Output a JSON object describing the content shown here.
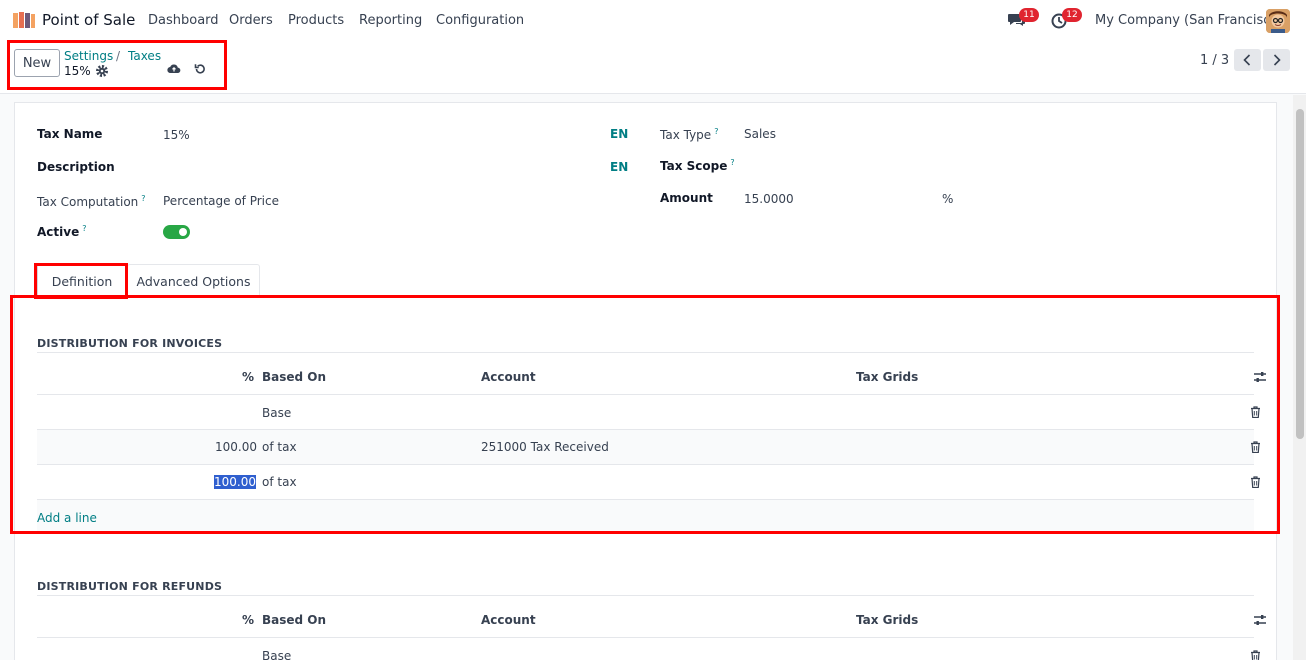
{
  "navbar": {
    "app_name": "Point of Sale",
    "menus": [
      "Dashboard",
      "Orders",
      "Products",
      "Reporting",
      "Configuration"
    ],
    "messages_count": "11",
    "activities_count": "12",
    "company": "My Company (San Francisco)"
  },
  "control": {
    "new_label": "New",
    "breadcrumb": [
      "Settings",
      "Taxes"
    ],
    "breadcrumb_sep": "/",
    "record_name": "15%",
    "pager": "1 / 3"
  },
  "form": {
    "tax_name_label": "Tax Name",
    "tax_name_value": "15%",
    "description_label": "Description",
    "lang_tag": "EN",
    "tax_computation_label": "Tax Computation",
    "tax_computation_value": "Percentage of Price",
    "active_label": "Active",
    "active_value": true,
    "tax_type_label": "Tax Type",
    "tax_type_value": "Sales",
    "tax_scope_label": "Tax Scope",
    "amount_label": "Amount",
    "amount_value": "15.0000",
    "amount_unit": "%",
    "help_mark": "?"
  },
  "tabs": [
    "Definition",
    "Advanced Options"
  ],
  "invoices": {
    "title": "DISTRIBUTION FOR INVOICES",
    "columns": [
      "%",
      "Based On",
      "Account",
      "Tax Grids"
    ],
    "rows": [
      {
        "percent": "",
        "based_on": "Base",
        "account": ""
      },
      {
        "percent": "100.00",
        "based_on": "of tax",
        "account": "251000 Tax Received"
      },
      {
        "percent": "100.00",
        "based_on": "of tax",
        "account": ""
      }
    ],
    "add_line": "Add a line"
  },
  "refunds": {
    "title": "DISTRIBUTION FOR REFUNDS",
    "columns": [
      "%",
      "Based On",
      "Account",
      "Tax Grids"
    ],
    "rows": [
      {
        "percent": "",
        "based_on": "Base",
        "account": ""
      }
    ]
  },
  "colors": {
    "accent": "#017e84",
    "highlight": "#ff0000",
    "toggle_on": "#28a745",
    "badge": "#e0242f"
  }
}
